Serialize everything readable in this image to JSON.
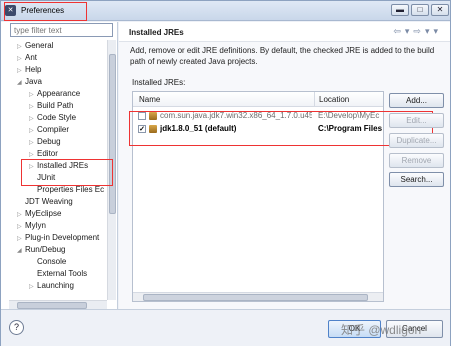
{
  "window": {
    "title": "Preferences",
    "filter_placeholder": "type filter text"
  },
  "tree": [
    {
      "label": "General",
      "arrow": "▷"
    },
    {
      "label": "Ant",
      "arrow": "▷"
    },
    {
      "label": "Help",
      "arrow": "▷"
    },
    {
      "label": "Java",
      "arrow": "◢"
    },
    {
      "label": "Appearance",
      "arrow": "▷"
    },
    {
      "label": "Build Path",
      "arrow": "▷"
    },
    {
      "label": "Code Style",
      "arrow": "▷"
    },
    {
      "label": "Compiler",
      "arrow": "▷"
    },
    {
      "label": "Debug",
      "arrow": "▷"
    },
    {
      "label": "Editor",
      "arrow": "▷"
    },
    {
      "label": "Installed JREs",
      "arrow": "▷"
    },
    {
      "label": "JUnit",
      "arrow": ""
    },
    {
      "label": "Properties Files Ec",
      "arrow": ""
    },
    {
      "label": "JDT Weaving",
      "arrow": ""
    },
    {
      "label": "MyEclipse",
      "arrow": "▷"
    },
    {
      "label": "Mylyn",
      "arrow": "▷"
    },
    {
      "label": "Plug-in Development",
      "arrow": "▷"
    },
    {
      "label": "Run/Debug",
      "arrow": "◢"
    },
    {
      "label": "Console",
      "arrow": ""
    },
    {
      "label": "External Tools",
      "arrow": ""
    },
    {
      "label": "Launching",
      "arrow": "▷"
    }
  ],
  "page": {
    "title": "Installed JREs",
    "description": "Add, remove or edit JRE definitions. By default, the checked JRE is added to the build path of newly created Java projects.",
    "list_label": "Installed JREs:",
    "col_name": "Name",
    "col_location": "Location",
    "rows": [
      {
        "name": "com.sun.java.jdk7.win32.x86_64_1.7.0.u45",
        "location": "E:\\Develop\\MyEc",
        "checked": "",
        "default": false
      },
      {
        "name": "jdk1.8.0_51 (default)",
        "location": "C:\\Program Files",
        "checked": "✓",
        "default": true
      }
    ]
  },
  "buttons": {
    "add": "Add...",
    "edit": "Edit...",
    "duplicate": "Duplicate...",
    "remove": "Remove",
    "search": "Search..."
  },
  "footer": {
    "help": "?",
    "ok": "OK",
    "cancel": "Cancel",
    "watermark": "知乎 @wdligon"
  },
  "colors": {
    "highlight_border": "#ee3333",
    "title_bar": "#c9d7ea"
  }
}
